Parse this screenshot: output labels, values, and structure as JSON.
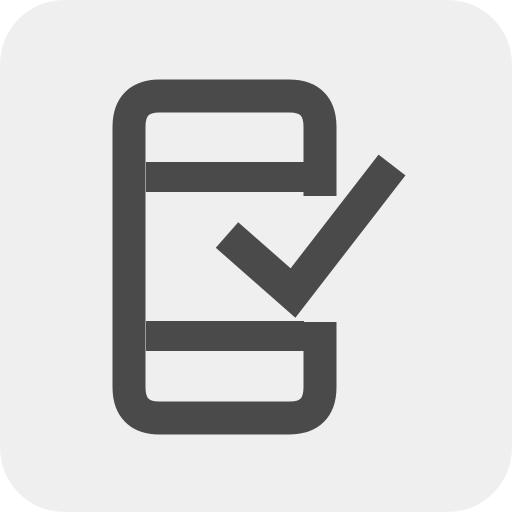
{
  "icon": {
    "name": "mobile-check-icon",
    "description_role": "app-icon",
    "colors": {
      "tile_background": "#efefef",
      "glyph": "#4a4a4a"
    }
  }
}
